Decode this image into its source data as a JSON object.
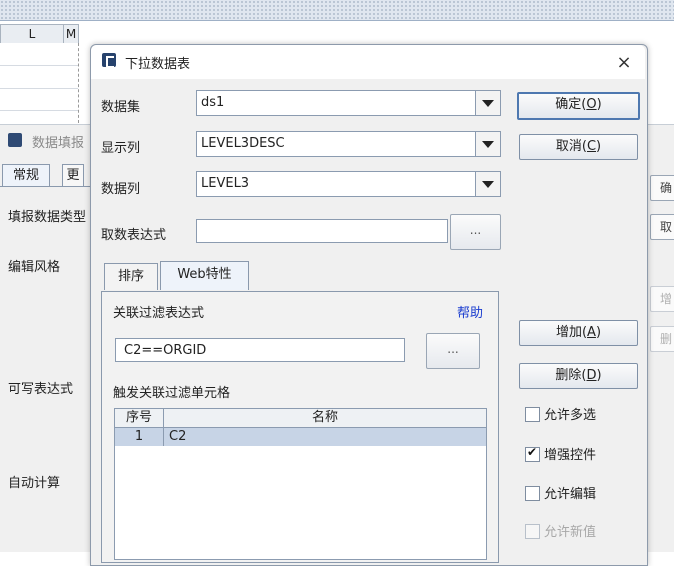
{
  "spreadsheet": {
    "col_L": "L",
    "col_M": "M"
  },
  "background_dialog": {
    "title": "数据填报",
    "tab_general": "常规",
    "tab_more": "更",
    "label_fill_type": "填报数据类型",
    "label_edit_style": "编辑风格",
    "label_writable_expr": "可写表达式",
    "label_auto_calc": "自动计算",
    "right_btn_1": "确",
    "right_btn_2": "取",
    "right_btn_3": "增",
    "right_btn_4": "删"
  },
  "dialog": {
    "title": "下拉数据表",
    "close": "×",
    "dataset_label": "数据集",
    "dataset_value": "ds1",
    "display_col_label": "显示列",
    "display_col_value": "LEVEL3DESC",
    "data_col_label": "数据列",
    "data_col_value": "LEVEL3",
    "expr_label": "取数表达式",
    "expr_value": "",
    "expr_button": "...",
    "ok_text": "确定(",
    "ok_key": "O",
    "cancel_text": "取消(",
    "cancel_key": "C",
    "tabs": [
      "排序",
      "Web特性"
    ],
    "filter_label": "关联过滤表达式",
    "help_link": "帮助",
    "filter_value": "C2==ORGID",
    "filter_button": "...",
    "trigger_label": "触发关联过滤单元格",
    "table_headers": [
      "序号",
      "名称"
    ],
    "table_rows": [
      {
        "index": "1",
        "name": "C2"
      }
    ],
    "add_text": "增加(",
    "add_key": "A",
    "delete_text": "删除(",
    "delete_key": "D",
    "checkboxes": [
      {
        "label": "允许多选",
        "checked": false,
        "enabled": true
      },
      {
        "label": "增强控件",
        "checked": true,
        "enabled": true
      },
      {
        "label": "允许编辑",
        "checked": false,
        "enabled": true
      },
      {
        "label": "允许新值",
        "checked": false,
        "enabled": false
      }
    ]
  }
}
